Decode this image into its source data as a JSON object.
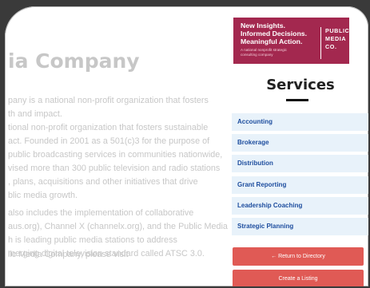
{
  "page": {
    "title": "ia Company",
    "paragraphs": [
      [
        "pany is a national non-profit organization that fosters",
        "th and impact."
      ],
      [
        "tional non-profit organization that fosters sustainable",
        "act. Founded in 2001 as a 501(c)3 for the purpose of",
        "public broadcasting services in communities nationwide,",
        "vised more than 300 public television and radio stations",
        ", plans, acquisitions and other initiatives that drive",
        "blic media growth."
      ],
      [
        " also includes the implementation of collaborative",
        "aus.org), Channel X (channelx.org), and the Public Media",
        "h is leading public media stations to address",
        "merging digital television standard called ATSC 3.0."
      ],
      [
        "lic Media Company, please visit"
      ]
    ]
  },
  "banner": {
    "headline": [
      "New Insights.",
      "Informed Decisions.",
      "Meaningful Action."
    ],
    "subtext": [
      "A national nonprofit strategic",
      "consulting company"
    ],
    "logo": [
      "PUBLIC",
      "MEDIA",
      "CO."
    ]
  },
  "services": {
    "title": "Services",
    "items": [
      "Accounting",
      "Brokerage",
      "Distribution",
      "Grant Reporting",
      "Leadership Coaching",
      "Strategic Planning"
    ]
  },
  "buttons": {
    "return": "← Return to Directory",
    "create": "Create a Listing"
  },
  "colors": {
    "banner_bg": "#a3284f",
    "service_bg": "#e8f2fa",
    "service_text": "#1d4d9e",
    "button_bg": "#e05a55",
    "body_text": "#c7c7c7"
  }
}
